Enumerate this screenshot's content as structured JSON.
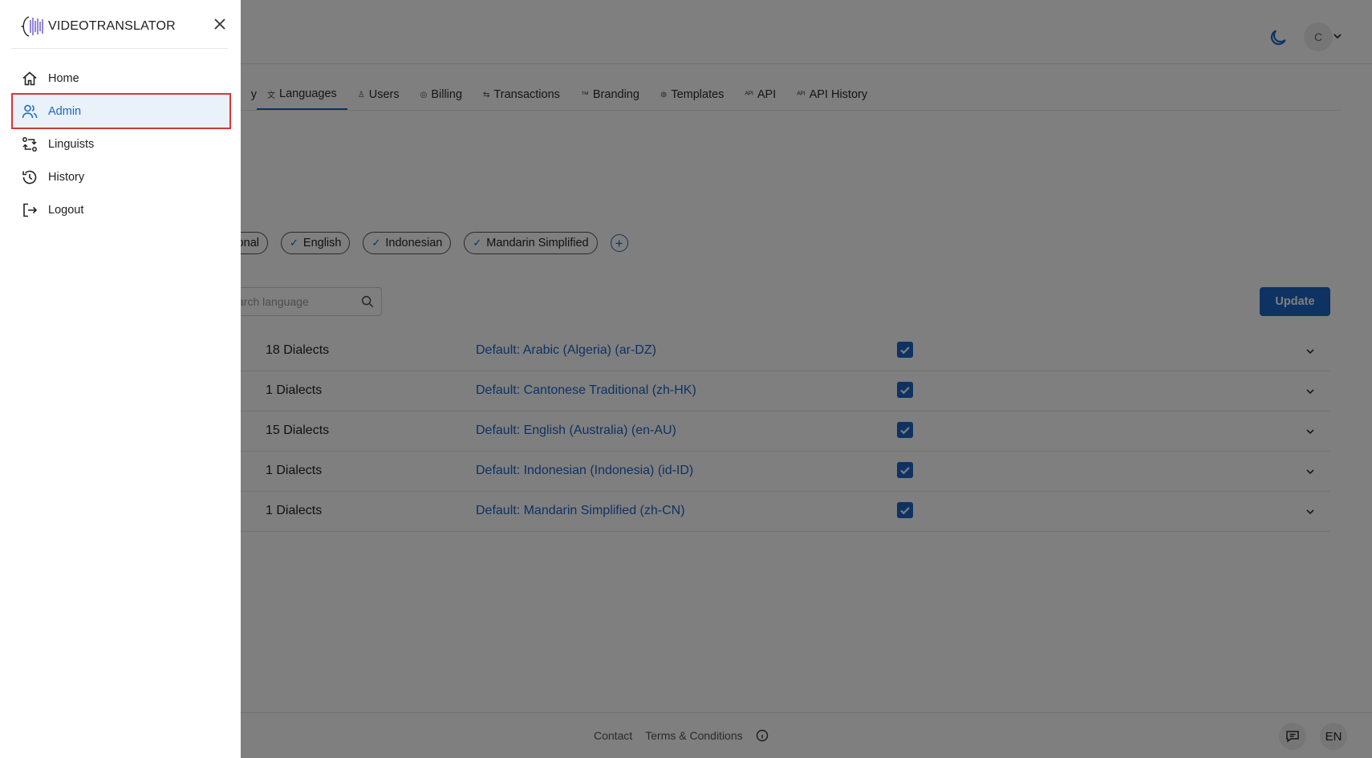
{
  "app": {
    "title": "VIDEOTRANSLATOR"
  },
  "header": {
    "avatar_initial": "C"
  },
  "tabs": [
    {
      "label": "y",
      "icon": ""
    },
    {
      "label": "Languages",
      "icon": "translate-icon"
    },
    {
      "label": "Users",
      "icon": "user-icon"
    },
    {
      "label": "Billing",
      "icon": "billing-icon"
    },
    {
      "label": "Transactions",
      "icon": "transactions-icon"
    },
    {
      "label": "Branding",
      "icon": "trademark-icon"
    },
    {
      "label": "Templates",
      "icon": "templates-icon"
    },
    {
      "label": "API",
      "icon": "api-icon"
    },
    {
      "label": "API History",
      "icon": "api-icon"
    }
  ],
  "chips": [
    "onal",
    "English",
    "Indonesian",
    "Mandarin Simplified"
  ],
  "search": {
    "placeholder": "arch language"
  },
  "actions": {
    "update_label": "Update"
  },
  "languages_table": [
    {
      "dialects": "18 Dialects",
      "default": "Default: Arabic (Algeria) (ar-DZ)",
      "checked": true
    },
    {
      "dialects": "1 Dialects",
      "default": "Default: Cantonese Traditional (zh-HK)",
      "checked": true
    },
    {
      "dialects": "15 Dialects",
      "default": "Default: English (Australia) (en-AU)",
      "checked": true
    },
    {
      "dialects": "1 Dialects",
      "default": "Default: Indonesian (Indonesia) (id-ID)",
      "checked": true
    },
    {
      "dialects": "1 Dialects",
      "default": "Default: Mandarin Simplified (zh-CN)",
      "checked": true
    }
  ],
  "footer": {
    "contact": "Contact",
    "terms": "Terms & Conditions",
    "lang": "EN"
  },
  "sidebar": {
    "items": [
      {
        "label": "Home",
        "icon": "home-icon"
      },
      {
        "label": "Admin",
        "icon": "users-icon",
        "active": true
      },
      {
        "label": "Linguists",
        "icon": "swap-icon"
      },
      {
        "label": "History",
        "icon": "history-icon"
      },
      {
        "label": "Logout",
        "icon": "logout-icon"
      }
    ]
  },
  "colors": {
    "accent": "#1c64c4",
    "highlight_border": "#d93636",
    "overlay": "#000000"
  }
}
